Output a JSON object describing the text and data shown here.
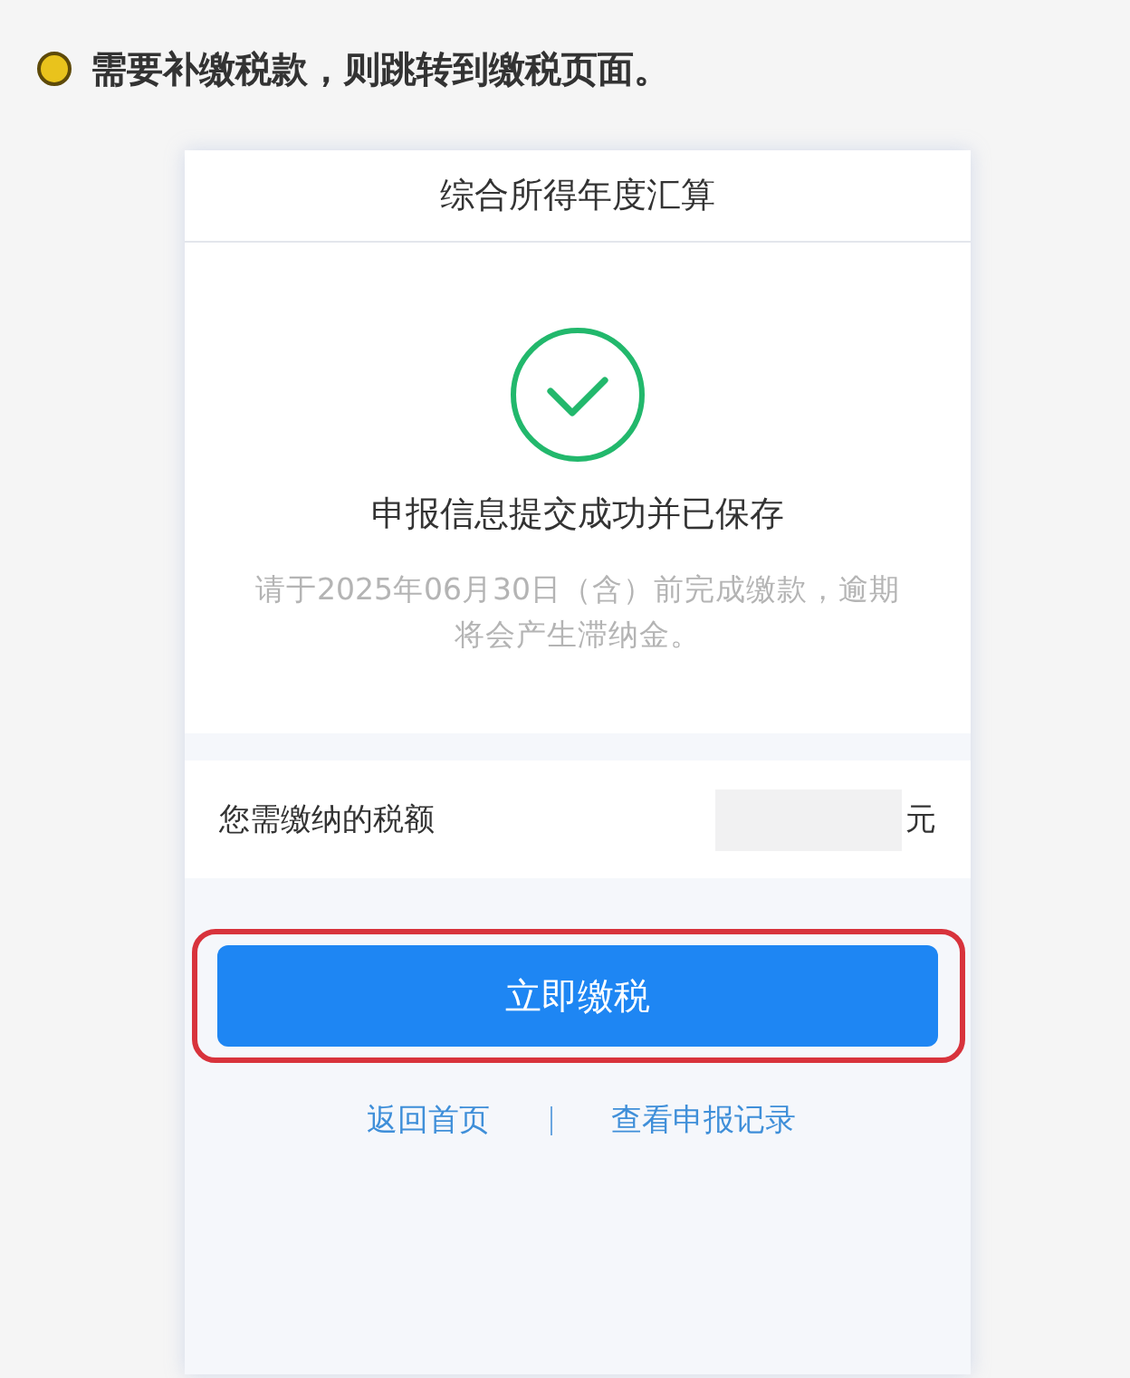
{
  "note": "需要补缴税款，则跳转到缴税页面。",
  "screen": {
    "title": "综合所得年度汇算",
    "status": {
      "kind": "success",
      "heading": "申报信息提交成功并已保存",
      "message": "请于2025年06月30日（含）前完成缴款，逾期将会产生滞纳金。"
    },
    "tax_row": {
      "label": "您需缴纳的税额",
      "unit": "元"
    },
    "primary_button": {
      "label": "立即缴税",
      "highlighted": true
    },
    "links": [
      "返回首页",
      "查看申报记录"
    ]
  }
}
